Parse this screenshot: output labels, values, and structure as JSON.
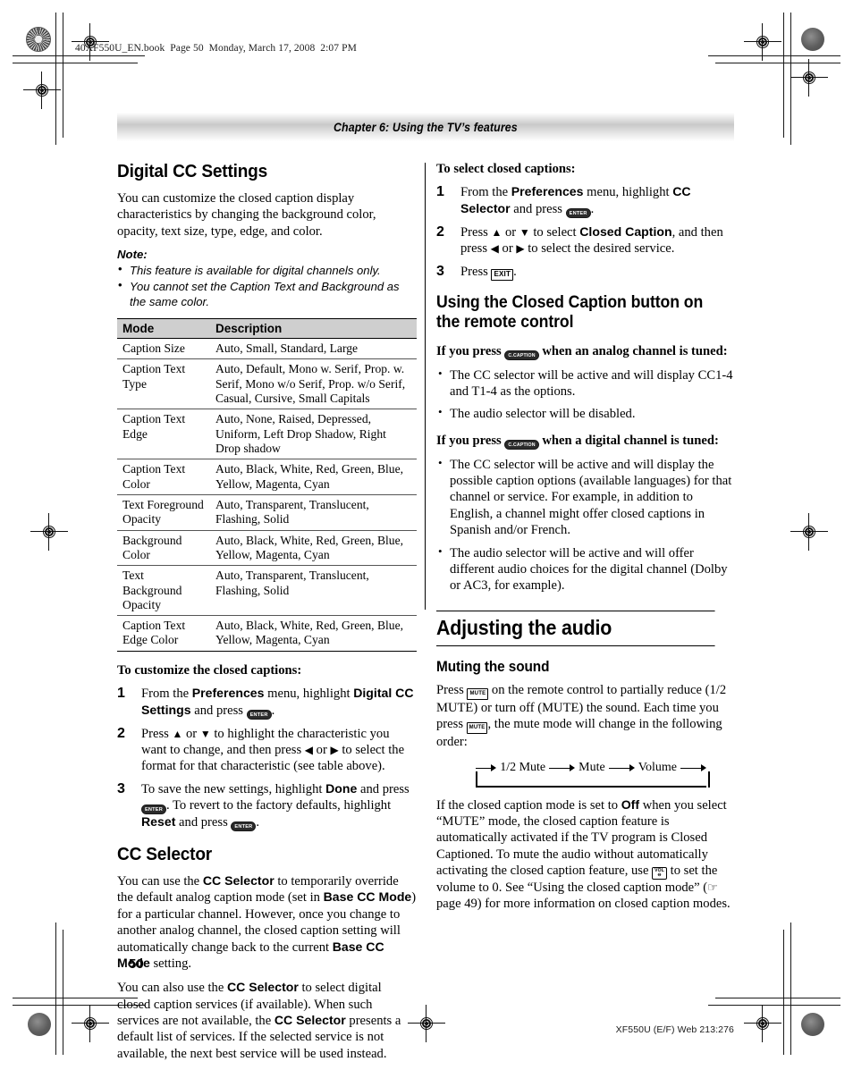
{
  "print_header": "40XF550U_EN.book  Page 50  Monday, March 17, 2008  2:07 PM",
  "chapter_bar": "Chapter 6: Using the TV’s features",
  "page_number": "50",
  "footer_code": "XF550U (E/F) Web 213:276",
  "left_column": {
    "heading": "Digital CC Settings",
    "intro": "You can customize the closed caption display characteristics by changing the background color, opacity, text size, type, edge, and color.",
    "note_label": "Note:",
    "notes": [
      "This feature is available for digital channels only.",
      "You cannot set the Caption Text and Background as the same color."
    ],
    "table": {
      "headers": [
        "Mode",
        "Description"
      ],
      "rows": [
        [
          "Caption Size",
          "Auto, Small, Standard, Large"
        ],
        [
          "Caption Text Type",
          "Auto, Default, Mono w. Serif, Prop. w. Serif, Mono w/o Serif, Prop. w/o Serif, Casual, Cursive, Small Capitals"
        ],
        [
          "Caption Text Edge",
          "Auto, None, Raised, Depressed, Uniform, Left Drop Shadow, Right Drop shadow"
        ],
        [
          "Caption Text Color",
          "Auto, Black, White, Red, Green, Blue, Yellow, Magenta, Cyan"
        ],
        [
          "Text Foreground Opacity",
          "Auto, Transparent, Translucent, Flashing, Solid"
        ],
        [
          "Background Color",
          "Auto, Black, White, Red, Green, Blue, Yellow, Magenta, Cyan"
        ],
        [
          "Text Background Opacity",
          "Auto, Transparent, Translucent, Flashing, Solid"
        ],
        [
          "Caption Text Edge Color",
          "Auto, Black, White, Red, Green, Blue, Yellow, Magenta, Cyan"
        ]
      ]
    },
    "customize_lead": "To customize the closed captions:",
    "steps": {
      "s1_a": "From the ",
      "s1_b": "Preferences",
      "s1_c": " menu, highlight ",
      "s1_d": "Digital CC Settings",
      "s1_e": " and press ",
      "s1_key": "ENTER",
      "s1_f": ".",
      "s2_a": "Press ",
      "s2_up": "▲",
      "s2_b": " or ",
      "s2_dn": "▼",
      "s2_c": " to highlight the characteristic you want to change, and then press ",
      "s2_lt": "◀",
      "s2_d": " or ",
      "s2_rt": "▶",
      "s2_e": " to select the format for that characteristic (see table above).",
      "s3_a": "To save the new settings, highlight ",
      "s3_b": "Done",
      "s3_c": " and press ",
      "s3_key1": "ENTER",
      "s3_d": ". To revert to the factory defaults, highlight ",
      "s3_e": "Reset",
      "s3_f": " and press ",
      "s3_key2": "ENTER",
      "s3_g": "."
    },
    "cc_selector_heading": "CC Selector",
    "cc_p1_a": "You can use the ",
    "cc_p1_b": "CC Selector",
    "cc_p1_c": " to temporarily override the default analog caption mode (set in ",
    "cc_p1_d": "Base CC Mode",
    "cc_p1_e": ") for a particular channel. However, once you change to another analog channel, the closed caption setting will automatically change back to the current ",
    "cc_p1_f": "Base CC Mode",
    "cc_p1_g": " setting.",
    "cc_p2_a": "You can also use the ",
    "cc_p2_b": "CC Selector",
    "cc_p2_c": " to select digital closed caption services (if available). When such services are not available, the ",
    "cc_p2_d": "CC Selector",
    "cc_p2_e": " presents a default list of services. If the selected service is not available, the next best service will be used instead."
  },
  "right_column": {
    "select_lead": "To select closed captions:",
    "steps": {
      "s1_a": "From the ",
      "s1_b": "Preferences",
      "s1_c": " menu, highlight ",
      "s1_d": "CC Selector",
      "s1_e": " and press ",
      "s1_key": "ENTER",
      "s1_f": ".",
      "s2_a": "Press ",
      "s2_up": "▲",
      "s2_b": " or ",
      "s2_dn": "▼",
      "s2_c": " to select ",
      "s2_d": "Closed Caption",
      "s2_e": ", and then press ",
      "s2_lt": "◀",
      "s2_f": " or ",
      "s2_rt": "▶",
      "s2_g": " to select the desired service.",
      "s3_a": "Press ",
      "s3_key": "EXIT",
      "s3_b": "."
    },
    "remote_heading": "Using the Closed Caption button on the remote control",
    "analog_lead_a": "If you press ",
    "analog_key": "C.CAPTION",
    "analog_lead_b": " when an analog channel is tuned:",
    "analog_bullets": [
      "The CC selector will be active and will display CC1-4 and T1-4 as the options.",
      "The audio selector will be disabled."
    ],
    "digital_lead_a": "If you press ",
    "digital_key": "C.CAPTION",
    "digital_lead_b": " when a digital channel is tuned:",
    "digital_bullets": [
      "The CC selector will be active and will display the possible caption options (available languages) for that channel or service. For example, in addition to English, a channel might offer closed captions in Spanish and/or French.",
      "The audio selector will be active and will offer different audio choices for the digital channel (Dolby or AC3, for example)."
    ],
    "audio_heading": "Adjusting the audio",
    "mute_heading": "Muting the sound",
    "mute_p_a": "Press ",
    "mute_key1": "MUTE",
    "mute_p_b": " on the remote control to partially reduce (1/2 MUTE) or turn off (MUTE) the sound. Each time you press ",
    "mute_key2": "MUTE",
    "mute_p_c": ", the mute mode will change in the following order:",
    "cycle": [
      "1/2 Mute",
      "Mute",
      "Volume"
    ],
    "final_a": "If the closed caption mode is set to ",
    "final_b": "Off",
    "final_c": " when you select “MUTE” mode, the closed caption feature is automatically activated if the TV program is Closed Captioned. To mute the audio without automatically activating the closed caption feature, use ",
    "final_volkey_top": "VOL",
    "final_volkey_bot": "⊖",
    "final_d": " to set the volume to 0. See “Using the closed caption mode” (",
    "final_hand": "☞",
    "final_e": " page 49) for more information on closed caption modes."
  }
}
